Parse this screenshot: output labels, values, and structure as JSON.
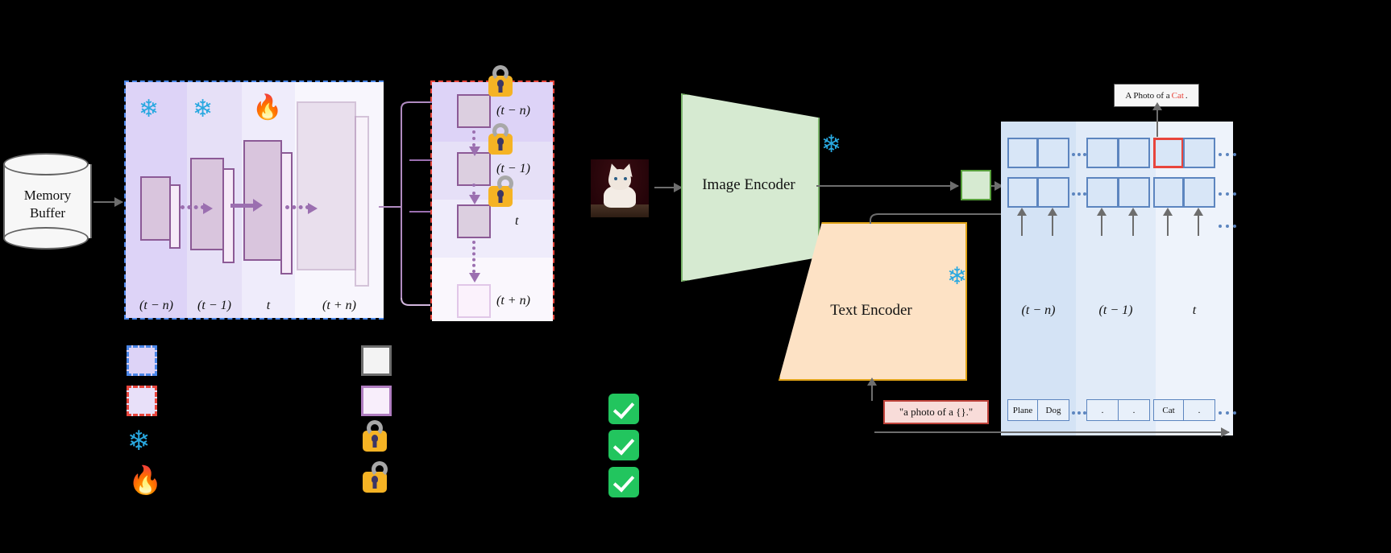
{
  "memory_buffer": {
    "label": "Memory\nBuffer",
    "line1": "Memory",
    "line2": "Buffer"
  },
  "model_panel": {
    "border_color": "#4a86e8",
    "stages": [
      {
        "label": "(t − n)",
        "icon": "snowflake-icon",
        "icon_glyph": "❄"
      },
      {
        "label": "(t − 1)",
        "icon": "snowflake-icon",
        "icon_glyph": "❄"
      },
      {
        "label": "t",
        "icon": "flame-icon",
        "icon_glyph": "🔥"
      },
      {
        "label": "(t + n)",
        "icon": "none",
        "icon_glyph": ""
      }
    ]
  },
  "prompt_panel": {
    "border_color": "#e8453c",
    "rows": [
      {
        "label": "(t − n)",
        "lock": "locked"
      },
      {
        "label": "(t − 1)",
        "lock": "locked"
      },
      {
        "label": "t",
        "lock": "unlocked"
      },
      {
        "label": "(t + n)",
        "lock": "none"
      }
    ]
  },
  "legend": {
    "left_column": [
      {
        "name": "blue-dashed-swatch",
        "fill": "#ddd3f7",
        "border": "#4a86e8",
        "style": "dashed"
      },
      {
        "name": "red-dashed-swatch",
        "fill": "#e8e0f9",
        "border": "#e8453c",
        "style": "dashed"
      },
      {
        "name": "snowflake-icon",
        "glyph": "❄"
      },
      {
        "name": "flame-icon",
        "glyph": "🔥"
      }
    ],
    "right_column": [
      {
        "name": "gray-solid-swatch",
        "fill": "#f3f3f3",
        "border": "#6d6d6d",
        "style": "solid"
      },
      {
        "name": "purple-solid-swatch",
        "fill": "#f8eefb",
        "border": "#b07dc0",
        "style": "solid"
      },
      {
        "name": "lock-closed-icon",
        "state": "locked"
      },
      {
        "name": "lock-open-icon",
        "state": "unlocked"
      }
    ]
  },
  "checks": [
    {
      "name": "check-1",
      "color": "#22c55e"
    },
    {
      "name": "check-2",
      "color": "#22c55e"
    },
    {
      "name": "check-3",
      "color": "#22c55e"
    }
  ],
  "clip": {
    "image_encoder": {
      "label": "Image Encoder",
      "fill": "#d6ead1",
      "border": "#7ab36a",
      "frozen_icon": "❄"
    },
    "text_encoder": {
      "label": "Text Encoder",
      "fill": "#fde2c5",
      "border": "#e0a317",
      "frozen_icon": "❄"
    },
    "prompt_template": "\"a photo of a {}.\"",
    "image_thumbnail_alt": "cat-photo"
  },
  "matrix_panel": {
    "columns": [
      {
        "label": "(t − n)",
        "fill": "#d4e3f5"
      },
      {
        "label": "(t − 1)",
        "fill": "#e1ebf8"
      },
      {
        "label": "t",
        "fill": "#eef3fb"
      }
    ],
    "class_labels": [
      "Plane",
      "Dog",
      ".",
      ".",
      "Cat",
      "."
    ],
    "selected_cell": "Cat",
    "selected_color": "#e8453c"
  },
  "prediction": {
    "prefix": "A Photo of a ",
    "highlight": "Cat",
    "suffix": ".",
    "highlight_color": "#e8453c"
  }
}
